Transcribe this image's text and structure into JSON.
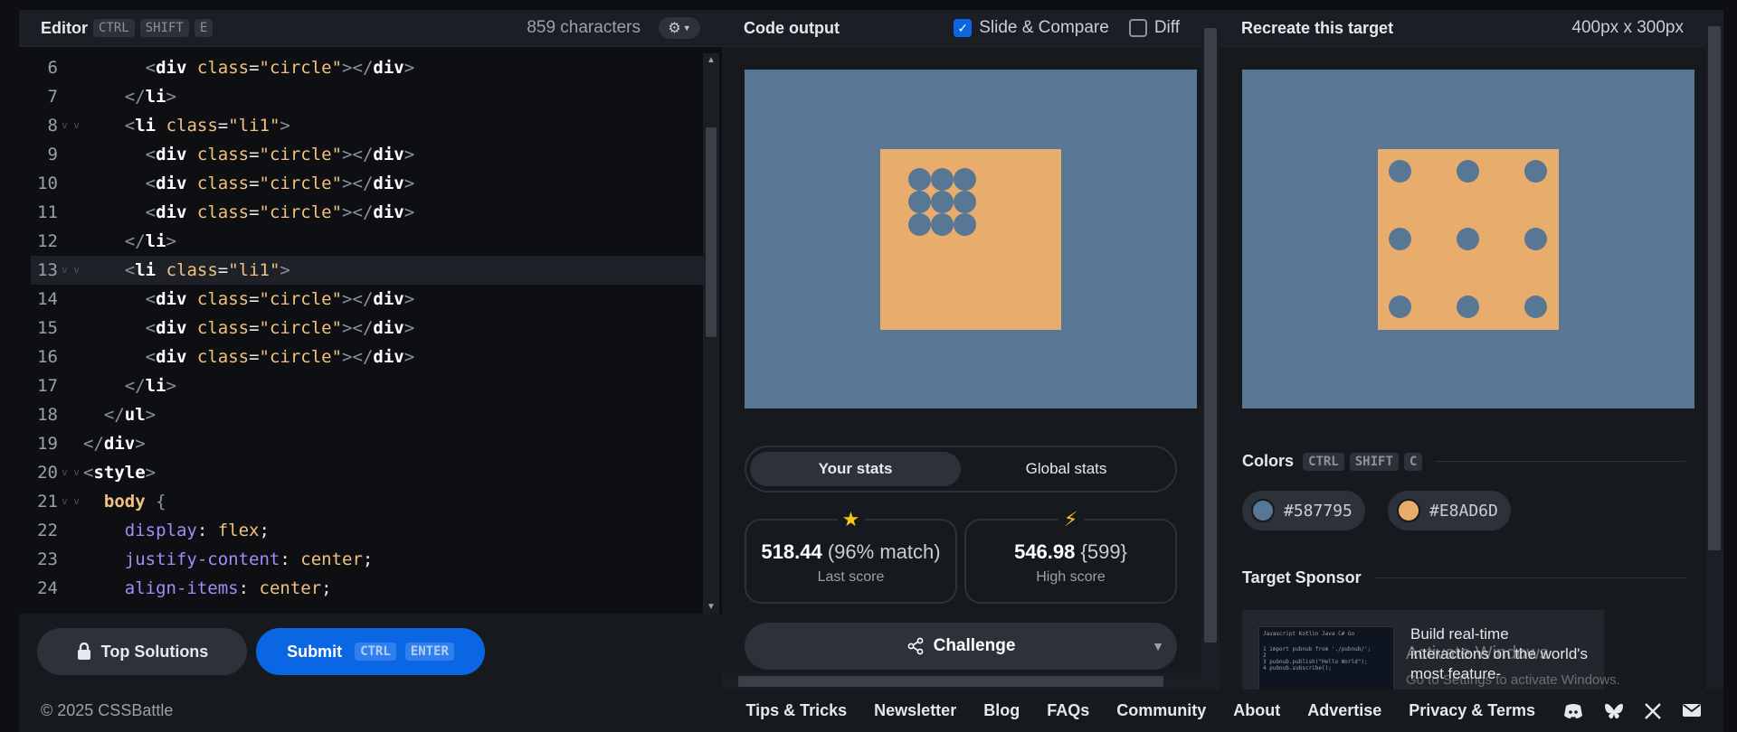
{
  "editor": {
    "title": "Editor",
    "shortcut": [
      "CTRL",
      "SHIFT",
      "E"
    ],
    "char_count": "859 characters",
    "active_line": 13,
    "lines": [
      {
        "n": "6",
        "fold": "",
        "code": "      <div class=\"circle\"></div>"
      },
      {
        "n": "7",
        "fold": "",
        "code": "    </li>"
      },
      {
        "n": "8",
        "fold": "v v",
        "code": "    <li class=\"li1\">"
      },
      {
        "n": "9",
        "fold": "",
        "code": "      <div class=\"circle\"></div>"
      },
      {
        "n": "10",
        "fold": "",
        "code": "      <div class=\"circle\"></div>"
      },
      {
        "n": "11",
        "fold": "",
        "code": "      <div class=\"circle\"></div>"
      },
      {
        "n": "12",
        "fold": "",
        "code": "    </li>"
      },
      {
        "n": "13",
        "fold": "v v",
        "code": "    <li class=\"li1\">"
      },
      {
        "n": "14",
        "fold": "",
        "code": "      <div class=\"circle\"></div>"
      },
      {
        "n": "15",
        "fold": "",
        "code": "      <div class=\"circle\"></div>"
      },
      {
        "n": "16",
        "fold": "",
        "code": "      <div class=\"circle\"></div>"
      },
      {
        "n": "17",
        "fold": "",
        "code": "    </li>"
      },
      {
        "n": "18",
        "fold": "",
        "code": "  </ul>"
      },
      {
        "n": "19",
        "fold": "",
        "code": "</div>"
      },
      {
        "n": "20",
        "fold": "v v",
        "code": "<style>"
      },
      {
        "n": "21",
        "fold": "v v",
        "code": "  body {"
      },
      {
        "n": "22",
        "fold": "",
        "code": "    display: flex;"
      },
      {
        "n": "23",
        "fold": "",
        "code": "    justify-content: center;"
      },
      {
        "n": "24",
        "fold": "",
        "code": "    align-items: center;"
      }
    ],
    "top_solutions_label": "Top Solutions",
    "submit_label": "Submit",
    "submit_shortcut": [
      "CTRL",
      "ENTER"
    ]
  },
  "output": {
    "title": "Code output",
    "slide_compare_label": "Slide & Compare",
    "slide_compare_checked": true,
    "diff_label": "Diff",
    "diff_checked": false,
    "tabs": [
      "Your stats",
      "Global stats"
    ],
    "last_score": {
      "value": "518.44",
      "extra": "(96% match)",
      "label": "Last score"
    },
    "high_score": {
      "value": "546.98",
      "extra": "{599}",
      "label": "High score"
    },
    "challenge_label": "Challenge"
  },
  "target": {
    "title": "Recreate this target",
    "dims": "400px x 300px",
    "colors_title": "Colors",
    "colors_shortcut": [
      "CTRL",
      "SHIFT",
      "C"
    ],
    "colors": [
      {
        "hex": "#587795"
      },
      {
        "hex": "#E8AD6D"
      }
    ],
    "sponsor_title": "Target Sponsor",
    "sponsor_text": "Build real-time interactions on the world's most feature-",
    "sponsor_thumb_tabs": "Javascript  Kotlin  Java  C#  Go",
    "sponsor_thumb_code": [
      "1 import pubnub from './pubnub/';",
      "2",
      "3 pubnub.publish(\"Hello World\");",
      "4 pubnub.subscribe();"
    ]
  },
  "watermark": {
    "line1": "Activate Windows",
    "line2": "Go to Settings to activate Windows."
  },
  "footer": {
    "copyright": "© 2025 CSSBattle",
    "links": [
      "Tips & Tricks",
      "Newsletter",
      "Blog",
      "FAQs",
      "Community",
      "About",
      "Advertise",
      "Privacy & Terms"
    ],
    "social_icons": [
      "discord-icon",
      "bluesky-icon",
      "x-icon",
      "mail-icon"
    ]
  }
}
